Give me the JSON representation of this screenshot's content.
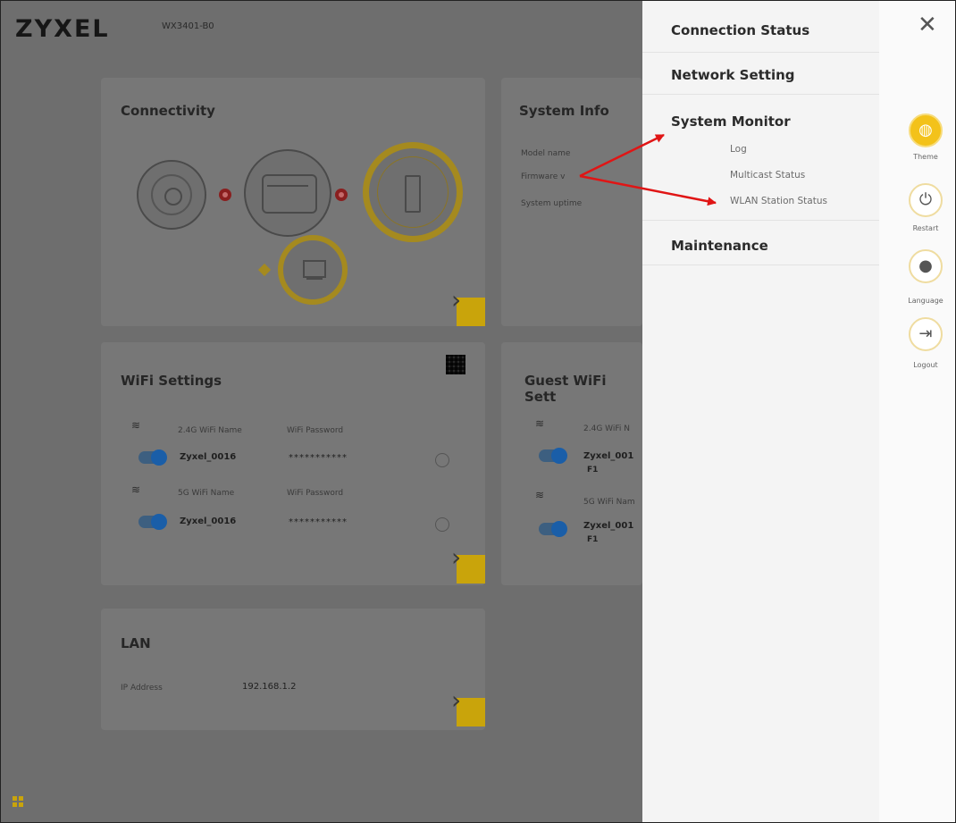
{
  "header": {
    "logo": "ZYXEL",
    "model": "WX3401-B0"
  },
  "connectivity": {
    "title": "Connectivity"
  },
  "system_info": {
    "title": "System Info",
    "labels": [
      "Model name",
      "Firmware v",
      "System uptime"
    ]
  },
  "wifi": {
    "title": "WiFi Settings",
    "rows": [
      {
        "band": "2.4G",
        "name_label": "2.4G WiFi Name",
        "pwd_label": "WiFi Password",
        "ssid": "Zyxel_0016",
        "password": "***********"
      },
      {
        "band": "5G",
        "name_label": "5G WiFi Name",
        "pwd_label": "WiFi Password",
        "ssid": "Zyxel_0016",
        "password": "***********"
      }
    ]
  },
  "guest_wifi": {
    "title": "Guest WiFi Sett",
    "rows": [
      {
        "band": "2.4G",
        "name_label": "2.4G WiFi N",
        "ssid": "Zyxel_001",
        "ssid_tail": "F1"
      },
      {
        "band": "5G",
        "name_label": "5G WiFi Nam",
        "ssid": "Zyxel_001",
        "ssid_tail": "F1"
      }
    ]
  },
  "lan": {
    "title": "LAN",
    "ip_label": "IP Address",
    "ip_value": "192.168.1.2"
  },
  "menu": {
    "connection_status": "Connection Status",
    "network_setting": "Network Setting",
    "system_monitor": "System Monitor",
    "sub_items": [
      "Log",
      "Multicast Status",
      "WLAN Station Status"
    ],
    "maintenance": "Maintenance"
  },
  "side_buttons": {
    "theme": "Theme",
    "restart": "Restart",
    "language": "Language",
    "logout": "Logout"
  },
  "colors": {
    "accent": "#f3c21a",
    "annotation_arrow": "#e01515"
  }
}
